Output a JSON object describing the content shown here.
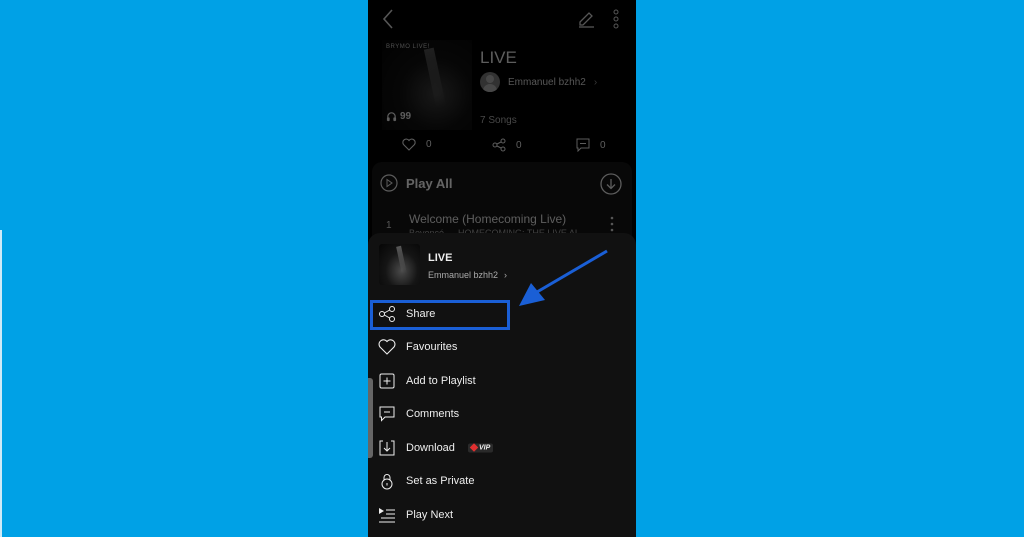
{
  "album": {
    "cover_title": "BRYMO LIVE!",
    "title": "LIVE",
    "artist": "Emmanuel bzhh2",
    "play_count": "99",
    "song_count": "7 Songs",
    "likes": "0",
    "shares": "0",
    "comments": "0"
  },
  "songlist": {
    "play_all_label": "Play All",
    "songs": [
      {
        "number": "1",
        "title": "Welcome (Homecoming Live)",
        "subtitle": "Beyoncé — HOMECOMING: THE LIVE AL"
      }
    ]
  },
  "sheet": {
    "title": "LIVE",
    "artist": "Emmanuel bzhh2",
    "menu": [
      {
        "label": "Share",
        "icon": "share-icon"
      },
      {
        "label": "Favourites",
        "icon": "heart-icon"
      },
      {
        "label": "Add to Playlist",
        "icon": "add-playlist-icon"
      },
      {
        "label": "Comments",
        "icon": "comment-icon"
      },
      {
        "label": "Download",
        "icon": "download-icon",
        "badge": "VIP"
      },
      {
        "label": "Set as Private",
        "icon": "lock-icon"
      },
      {
        "label": "Play Next",
        "icon": "play-next-icon"
      }
    ]
  },
  "colors": {
    "background": "#00a1e6",
    "highlight": "#1a5fd6",
    "vip_accent": "#e03030"
  }
}
